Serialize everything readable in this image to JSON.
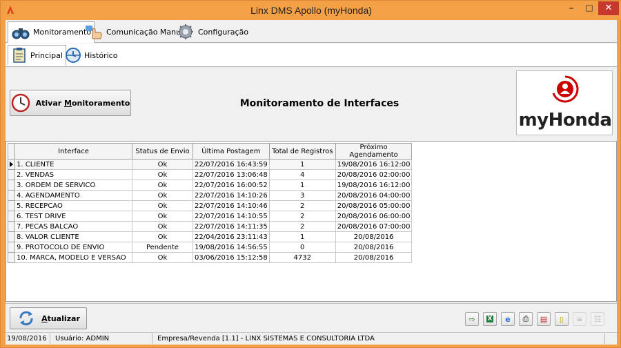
{
  "window": {
    "title": "Linx DMS Apollo (myHonda)",
    "controls": {
      "minimize": "–",
      "maximize": "□",
      "close": "✕"
    }
  },
  "top_tabs": [
    {
      "label": "Monitoramento",
      "icon": "binoculars-icon"
    },
    {
      "label": "Comunicação Manual",
      "icon": "hand-pointer-icon"
    },
    {
      "label": "Configuração",
      "icon": "gear-icon"
    }
  ],
  "sub_tabs": [
    {
      "label": "Principal",
      "icon": "clipboard-icon"
    },
    {
      "label": "Histórico",
      "icon": "history-clock-icon"
    }
  ],
  "header": {
    "activate_button": {
      "label_prefix": "Ativar ",
      "label_underlined": "M",
      "label_rest": "onitoramento",
      "icon": "clock-icon"
    },
    "title": "Monitoramento de Interfaces",
    "logo": {
      "text": "myHonda",
      "color": "#cc0000"
    }
  },
  "grid": {
    "columns": [
      "Interface",
      "Status de Envio",
      "Última Postagem",
      "Total de Registros",
      "Próximo Agendamento"
    ],
    "rows": [
      [
        "1. CLIENTE",
        "Ok",
        "22/07/2016 16:43:59",
        "1",
        "19/08/2016 16:12:00"
      ],
      [
        "2. VENDAS",
        "Ok",
        "22/07/2016 13:06:48",
        "4",
        "20/08/2016 02:00:00"
      ],
      [
        "3. ORDEM DE SERVICO",
        "Ok",
        "22/07/2016 16:00:52",
        "1",
        "19/08/2016 16:12:00"
      ],
      [
        "4. AGENDAMENTO",
        "Ok",
        "22/07/2016 14:10:26",
        "3",
        "20/08/2016 04:00:00"
      ],
      [
        "5. RECEPCAO",
        "Ok",
        "22/07/2016 14:10:46",
        "2",
        "20/08/2016 05:00:00"
      ],
      [
        "6. TEST DRIVE",
        "Ok",
        "22/07/2016 14:10:55",
        "2",
        "20/08/2016 06:00:00"
      ],
      [
        "7. PECAS BALCAO",
        "Ok",
        "22/07/2016 14:11:35",
        "2",
        "20/08/2016 07:00:00"
      ],
      [
        "8. VALOR CLIENTE",
        "Ok",
        "22/04/2016 23:11:43",
        "1",
        "20/08/2016"
      ],
      [
        "9. PROTOCOLO DE ENVIO",
        "Pendente",
        "19/08/2016 14:56:55",
        "0",
        "20/08/2016"
      ],
      [
        "10. MARCA, MODELO E VERSAO",
        "Ok",
        "03/06/2016 15:12:58",
        "4732",
        "20/08/2016"
      ]
    ],
    "selected_row": 0
  },
  "bottom": {
    "refresh_button": {
      "label_underlined": "A",
      "label_rest": "tualizar",
      "icon": "refresh-icon"
    },
    "toolbar_icons": [
      "export-icon",
      "excel-icon",
      "ie-browser-icon",
      "print-icon",
      "print-preview-icon",
      "document-icon",
      "prev-disabled-icon",
      "tree-disabled-icon"
    ]
  },
  "status": {
    "date": "19/08/2016",
    "user": "Usuário: ADMIN",
    "company": "Empresa/Revenda [1.1] - LINX SISTEMAS E CONSULTORIA LTDA"
  },
  "colors": {
    "window_accent": "#f3a047",
    "logo_red": "#cc0000"
  }
}
